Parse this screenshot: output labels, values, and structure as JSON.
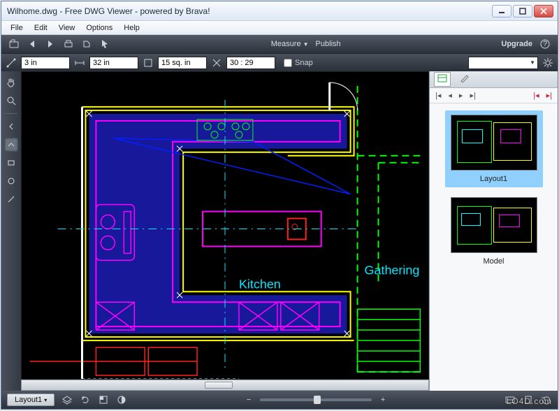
{
  "window": {
    "title": "Wilhome.dwg - Free DWG Viewer - powered by Brava!"
  },
  "menubar": {
    "items": [
      "File",
      "Edit",
      "View",
      "Options",
      "Help"
    ]
  },
  "toolbar1": {
    "measure_label": "Measure",
    "publish_label": "Publish",
    "upgrade_label": "Upgrade"
  },
  "toolbar2": {
    "field1": "3 in",
    "field2": "32 in",
    "field3": "15 sq. in",
    "field4": "30 : 29",
    "snap_label": "Snap",
    "combo_value": ""
  },
  "canvas": {
    "labels": {
      "kitchen": "Kitchen",
      "gathering": "Gathering"
    }
  },
  "rightpanel": {
    "thumbs": [
      {
        "caption": "Layout1",
        "selected": true
      },
      {
        "caption": "Model",
        "selected": false
      }
    ]
  },
  "statusbar": {
    "layout_tab": "Layout1"
  },
  "watermark": "LO4D.com",
  "colors": {
    "yellow": "#ffff00",
    "magenta": "#ff00ff",
    "green": "#00ff00",
    "cyan": "#00ffff",
    "blue": "#0020ff",
    "fill_blue": "#1a1aa8",
    "red": "#ff2020",
    "white": "#ffffff"
  }
}
